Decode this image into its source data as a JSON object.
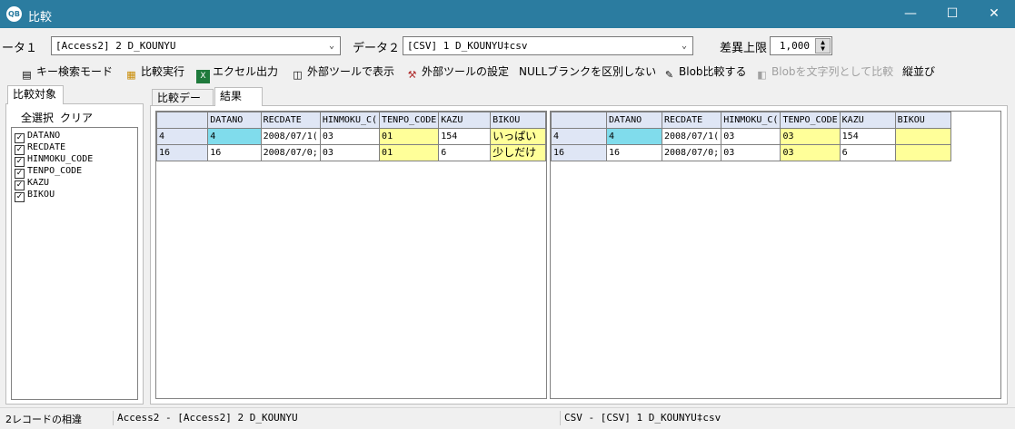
{
  "window": {
    "icon_text": "QB",
    "title": "比較",
    "minimize": "—",
    "maximize": "☐",
    "close": "✕"
  },
  "data1": {
    "label": "ータ１",
    "value": "[Access2] 2 D_KOUNYU"
  },
  "data2": {
    "label": "データ２",
    "value": "[CSV] 1 D_KOUNYU‡csv"
  },
  "diff_limit": {
    "label": "差異上限",
    "value": "1,000"
  },
  "toolbar": {
    "key_search": "キー検索モード",
    "compare_run": "比較実行",
    "excel_output": "エクセル出力",
    "external_view": "外部ツールで表示",
    "external_settings": "外部ツールの設定",
    "null_blank": "NULLブランクを区別しない",
    "blob_compare": "Blob比較する",
    "blob_as_string": "Blobを文字列として比較",
    "sort": "縦並び"
  },
  "left_panel": {
    "tab": "比較対象",
    "select_all": "全選択",
    "clear": "クリア",
    "fields": [
      "DATANO",
      "RECDATE",
      "HINMOKU_CODE",
      "TENPO_CODE",
      "KAZU",
      "BIKOU"
    ]
  },
  "tabs": {
    "compare_data": "比較データ",
    "result": "結果"
  },
  "grid_left": {
    "columns": [
      "DATANO",
      "RECDATE",
      "HINMOKU_C(",
      "TENPO_CODE",
      "KAZU",
      "BIKOU"
    ],
    "rows": [
      {
        "key": "4",
        "cells": [
          "4",
          "2008/07/1(",
          "03",
          "01",
          "154",
          "いっぱい"
        ]
      },
      {
        "key": "16",
        "cells": [
          "16",
          "2008/07/0;",
          "03",
          "01",
          "6",
          "少しだけ"
        ]
      }
    ]
  },
  "grid_right": {
    "columns": [
      "DATANO",
      "RECDATE",
      "HINMOKU_C(",
      "TENPO_CODE",
      "KAZU",
      "BIKOU"
    ],
    "rows": [
      {
        "key": "4",
        "cells": [
          "4",
          "2008/07/1(",
          "03",
          "03",
          "154",
          ""
        ]
      },
      {
        "key": "16",
        "cells": [
          "16",
          "2008/07/0;",
          "03",
          "03",
          "6",
          ""
        ]
      }
    ]
  },
  "status": {
    "diff_count": "2レコードの相違",
    "left_source": "Access2 - [Access2] 2 D_KOUNYU",
    "right_source": "CSV - [CSV] 1 D_KOUNYU‡csv"
  },
  "colors": {
    "titlebar": "#2b7ca0",
    "key_diff": "#80dcec",
    "value_diff": "#ffff99",
    "header": "#dfe6f5"
  }
}
